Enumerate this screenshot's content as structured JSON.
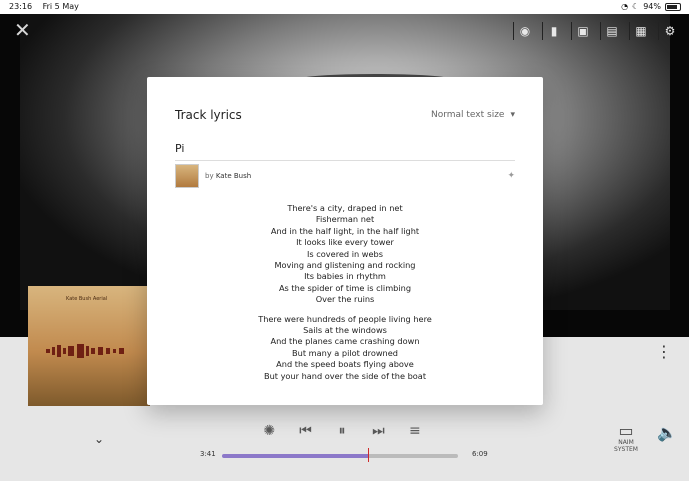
{
  "status_bar": {
    "time": "23:16",
    "date": "Fri 5 May",
    "battery": "94%"
  },
  "header": {
    "close_label": "✕",
    "icons": [
      {
        "name": "account-icon",
        "glyph": "◉"
      },
      {
        "name": "book-icon",
        "glyph": "▮"
      },
      {
        "name": "square-icon",
        "glyph": "▣"
      },
      {
        "name": "speaker-icon",
        "glyph": "▤"
      },
      {
        "name": "tablet-icon",
        "glyph": "▦"
      },
      {
        "name": "settings-icon",
        "glyph": "⚙"
      }
    ]
  },
  "modal": {
    "title": "Track lyrics",
    "text_size": "Normal text size",
    "song_title": "Pi",
    "by_prefix": "by",
    "artist": "Kate Bush",
    "lyrics": {
      "stanzas": [
        [
          "There's a city, draped in net",
          "Fisherman net",
          "And in the half light, in the half light",
          "It looks like every tower",
          "Is covered in webs",
          "Moving and glistening and rocking",
          "Its babies in rhythm",
          "As the spider of time is climbing",
          "Over the ruins"
        ],
        [
          "There were hundreds of people living here",
          "Sails at the windows",
          "And the planes came crashing down",
          "But many a pilot drowned",
          "And the speed boats flying above",
          "But your hand over the side of the boat"
        ]
      ]
    }
  },
  "player": {
    "album_artist": "Kate Bush",
    "album_title": "Aerial",
    "elapsed": "3:41",
    "duration": "6:09",
    "controls": [
      {
        "name": "visualizer-icon",
        "glyph": "✺"
      },
      {
        "name": "previous-icon",
        "glyph": "⏮"
      },
      {
        "name": "pause-icon",
        "glyph": "⏸"
      },
      {
        "name": "next-icon",
        "glyph": "⏭"
      },
      {
        "name": "queue-icon",
        "glyph": "≡"
      }
    ],
    "naim": "NAIM",
    "system": "SYSTEM"
  },
  "colors": {
    "accent": "#8c78c9",
    "playhead": "#cf2b2b"
  }
}
